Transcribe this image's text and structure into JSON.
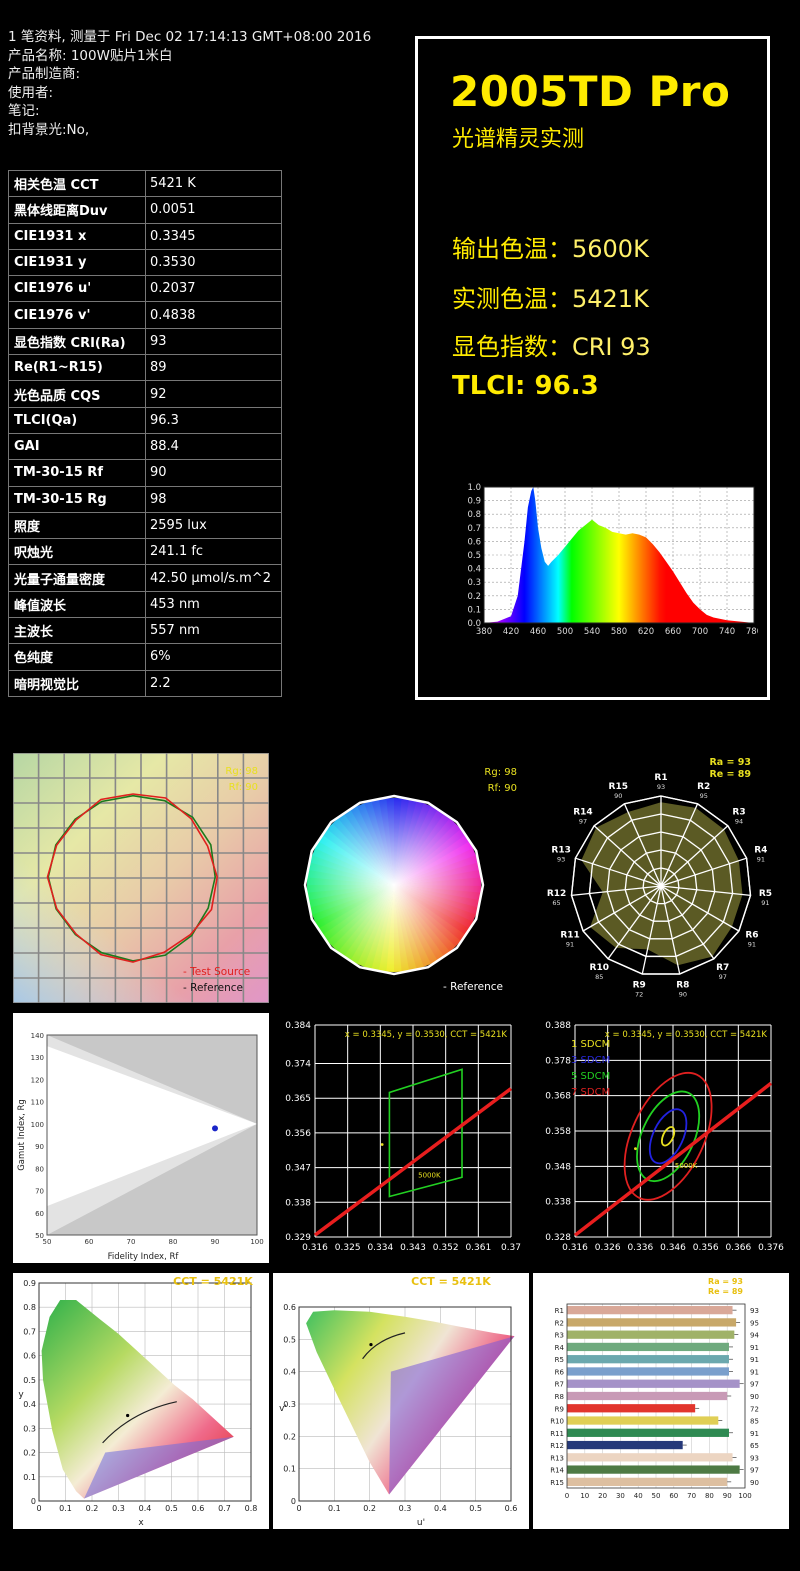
{
  "meta": {
    "line1": "1 笔资料, 测量于 Fri Dec 02 17:14:13 GMT+08:00 2016",
    "line2": "产品名称: 100W贴片1米白",
    "line3": "产品制造商:",
    "line4": "使用者:",
    "line5": "笔记:",
    "line6": "扣背景光:No,"
  },
  "table": [
    {
      "k": "相关色温 CCT",
      "v": "5421 K"
    },
    {
      "k": "黑体线距离Duv",
      "v": "0.0051"
    },
    {
      "k": "CIE1931 x",
      "v": "0.3345"
    },
    {
      "k": "CIE1931 y",
      "v": "0.3530"
    },
    {
      "k": "CIE1976 u'",
      "v": "0.2037"
    },
    {
      "k": "CIE1976 v'",
      "v": "0.4838"
    },
    {
      "k": "显色指数 CRI(Ra)",
      "v": "93"
    },
    {
      "k": "Re(R1~R15)",
      "v": "89"
    },
    {
      "k": "光色品质 CQS",
      "v": "92"
    },
    {
      "k": "TLCI(Qa)",
      "v": "96.3"
    },
    {
      "k": "GAI",
      "v": "88.4"
    },
    {
      "k": "TM-30-15 Rf",
      "v": "90"
    },
    {
      "k": "TM-30-15 Rg",
      "v": "98"
    },
    {
      "k": "照度",
      "v": "2595 lux"
    },
    {
      "k": "呎烛光",
      "v": "241.1 fc"
    },
    {
      "k": "光量子通量密度",
      "v": "42.50 μmol/s.m^2"
    },
    {
      "k": "峰值波长",
      "v": "453 nm"
    },
    {
      "k": "主波长",
      "v": "557 nm"
    },
    {
      "k": "色纯度",
      "v": "6%"
    },
    {
      "k": "暗明视觉比",
      "v": "2.2"
    }
  ],
  "panel": {
    "title": "2005TD Pro",
    "subtitle": "光谱精灵实测",
    "out_label": "输出色温：",
    "out_value": "5600K",
    "meas_label": "实测色温：",
    "meas_value": "5421K",
    "cri_label": "显色指数：",
    "cri_value": "CRI 93",
    "tlci_label": "TLCI:",
    "tlci_value": "96.3"
  },
  "labels": {
    "rg98": "Rg: 98",
    "rf90": "Rf: 90",
    "test_source": "- Test Source",
    "reference": "- Reference",
    "ra93": "Ra = 93",
    "re89": "Re = 89",
    "xy_readout": "x = 0.3345, y = 0.3530, CCT = 5421K",
    "cct_header": "CCT = 5421K",
    "k5000": "5000K",
    "gamut_axis": "Gamut Index, Rg",
    "fidelity_axis": "Fidelity Index, Rf",
    "sdcm1": "1 SDCM",
    "sdcm3": "3 SDCM",
    "sdcm5": "5 SDCM",
    "sdcm7": "7 SDCM",
    "x_axis": "x",
    "y_axis": "y",
    "u_axis": "u'",
    "v_axis": "v'"
  },
  "chart_data": [
    {
      "type": "area",
      "title": "",
      "x": [
        380,
        400,
        420,
        430,
        440,
        445,
        450,
        453,
        456,
        460,
        465,
        470,
        475,
        480,
        490,
        500,
        510,
        520,
        530,
        540,
        545,
        550,
        560,
        570,
        580,
        590,
        600,
        610,
        620,
        630,
        640,
        650,
        660,
        670,
        680,
        690,
        700,
        710,
        720,
        740,
        760,
        780
      ],
      "y": [
        0.0,
        0.01,
        0.05,
        0.2,
        0.6,
        0.85,
        0.97,
        1.0,
        0.9,
        0.7,
        0.55,
        0.45,
        0.42,
        0.45,
        0.5,
        0.56,
        0.62,
        0.68,
        0.72,
        0.76,
        0.74,
        0.72,
        0.7,
        0.67,
        0.66,
        0.65,
        0.66,
        0.65,
        0.63,
        0.58,
        0.52,
        0.45,
        0.38,
        0.3,
        0.22,
        0.15,
        0.1,
        0.06,
        0.04,
        0.02,
        0.01,
        0.0
      ],
      "xticks": [
        380,
        420,
        460,
        500,
        540,
        580,
        620,
        660,
        700,
        740,
        780
      ],
      "yticks": [
        0.0,
        0.1,
        0.2,
        0.3,
        0.4,
        0.5,
        0.6,
        0.7,
        0.8,
        0.9,
        1.0
      ],
      "xlim": [
        380,
        780
      ],
      "ylim": [
        0,
        1
      ]
    },
    {
      "type": "bar",
      "title": "",
      "categories": [
        "R1",
        "R2",
        "R3",
        "R4",
        "R5",
        "R6",
        "R7",
        "R8",
        "R9",
        "R10",
        "R11",
        "R12",
        "R13",
        "R14",
        "R15"
      ],
      "values": [
        93,
        95,
        94,
        91,
        91,
        91,
        97,
        90,
        72,
        85,
        91,
        65,
        93,
        97,
        90
      ],
      "colors": [
        "#d9a898",
        "#c8a869",
        "#a0b268",
        "#6faa7e",
        "#6ba8ae",
        "#7a9fcc",
        "#a592c8",
        "#c89ab6",
        "#e2352d",
        "#e0cf55",
        "#2e8a52",
        "#25397a",
        "#ecd5c2",
        "#4e7a44",
        "#ddbfa0"
      ],
      "xticks": [
        0,
        10,
        20,
        30,
        40,
        50,
        60,
        70,
        80,
        90,
        100
      ],
      "xlim": [
        0,
        100
      ]
    },
    {
      "type": "radar",
      "title": "",
      "categories": [
        "R1",
        "R2",
        "R3",
        "R4",
        "R5",
        "R6",
        "R7",
        "R8",
        "R9",
        "R10",
        "R11",
        "R12",
        "R13",
        "R14",
        "R15"
      ],
      "values": [
        93,
        95,
        94,
        91,
        91,
        91,
        97,
        90,
        72,
        85,
        91,
        65,
        93,
        97,
        90
      ]
    },
    {
      "type": "scatter",
      "title": "",
      "x": [
        90
      ],
      "y": [
        98
      ],
      "xlabel": "Fidelity Index, Rf",
      "ylabel": "Gamut Index, Rg",
      "xticks": [
        50,
        60,
        70,
        80,
        90,
        100
      ],
      "yticks": [
        50,
        60,
        70,
        80,
        90,
        100,
        110,
        120,
        130,
        140
      ],
      "xlim": [
        50,
        100
      ],
      "ylim": [
        50,
        140
      ]
    },
    {
      "type": "scatter",
      "title": "",
      "x": [
        0.3345
      ],
      "y": [
        0.353
      ],
      "xticks": [
        0.316,
        0.325,
        0.334,
        0.343,
        0.352,
        0.361,
        0.37
      ],
      "yticks": [
        0.329,
        0.338,
        0.347,
        0.356,
        0.365,
        0.374,
        0.384
      ],
      "xlim": [
        0.316,
        0.37
      ],
      "ylim": [
        0.329,
        0.384
      ]
    },
    {
      "type": "scatter",
      "title": "",
      "x": [
        0.3345
      ],
      "y": [
        0.353
      ],
      "xticks": [
        0.316,
        0.326,
        0.336,
        0.346,
        0.356,
        0.366,
        0.376
      ],
      "yticks": [
        0.328,
        0.338,
        0.348,
        0.358,
        0.368,
        0.378,
        0.388
      ],
      "xlim": [
        0.316,
        0.376
      ],
      "ylim": [
        0.328,
        0.388
      ]
    },
    {
      "type": "scatter",
      "title": "",
      "x": [
        0.3345
      ],
      "y": [
        0.353
      ],
      "xticks": [
        0,
        0.1,
        0.2,
        0.3,
        0.4,
        0.5,
        0.6,
        0.7,
        0.8
      ],
      "yticks": [
        0,
        0.1,
        0.2,
        0.3,
        0.4,
        0.5,
        0.6,
        0.7,
        0.8,
        0.9
      ],
      "xlim": [
        0,
        0.8
      ],
      "ylim": [
        0,
        0.9
      ]
    },
    {
      "type": "scatter",
      "title": "",
      "x": [
        0.2037
      ],
      "y": [
        0.4838
      ],
      "xticks": [
        0,
        0.1,
        0.2,
        0.3,
        0.4,
        0.5,
        0.6
      ],
      "yticks": [
        0,
        0.1,
        0.2,
        0.3,
        0.4,
        0.5,
        0.6
      ],
      "xlim": [
        0,
        0.6
      ],
      "ylim": [
        0,
        0.6
      ]
    }
  ]
}
